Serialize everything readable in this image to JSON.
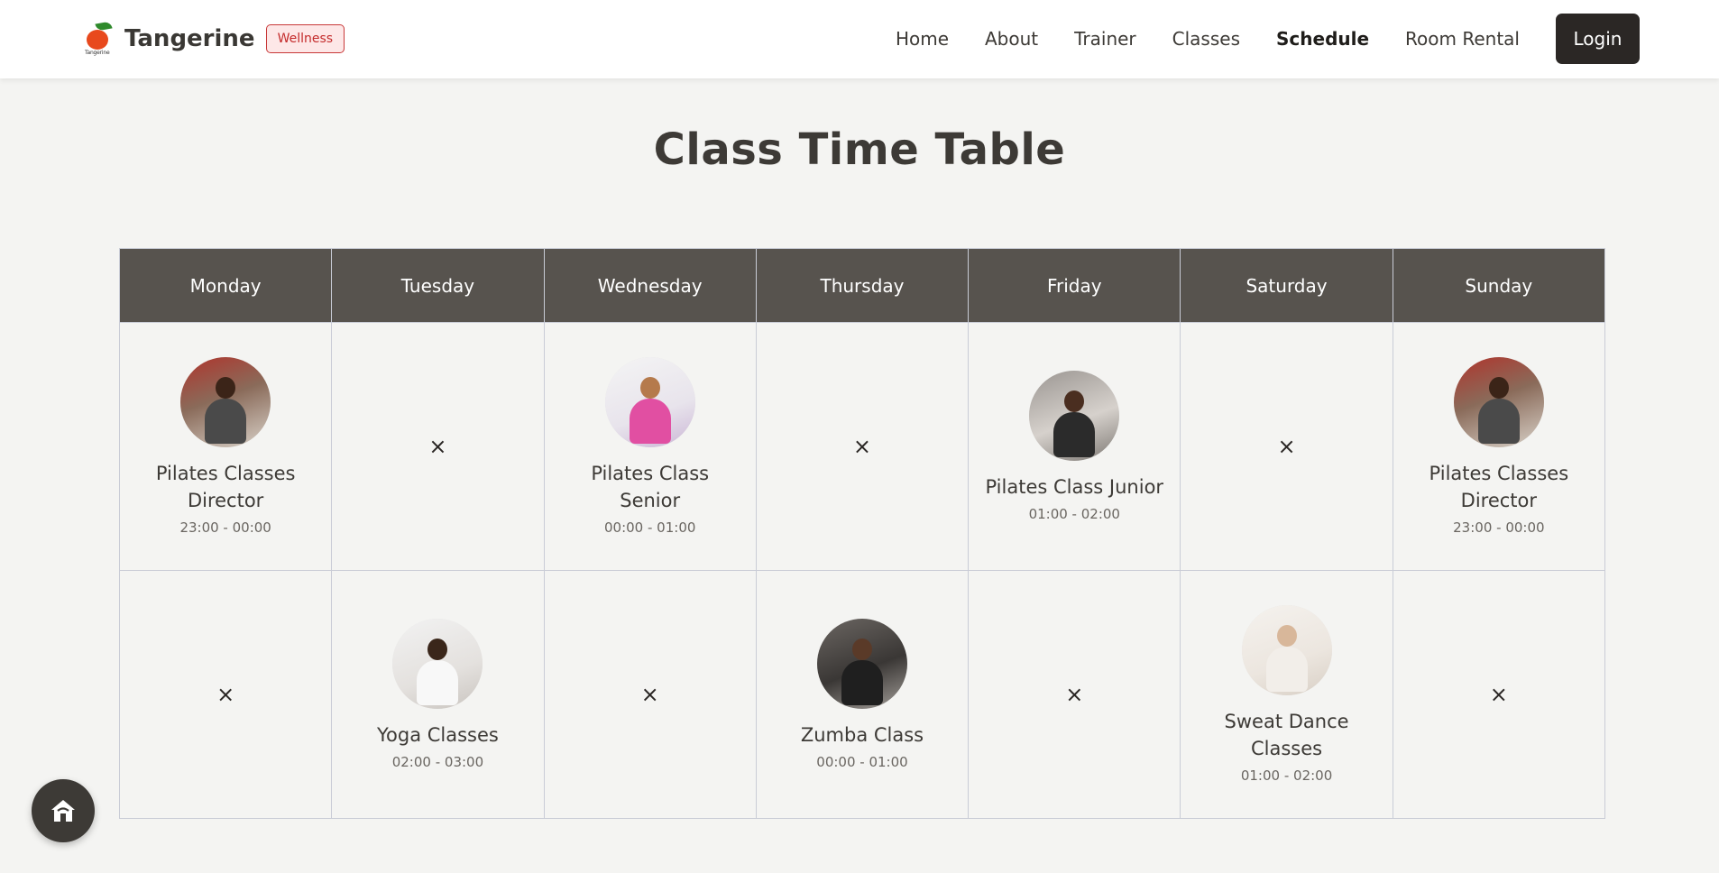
{
  "brand": {
    "name": "Tangerine",
    "badge": "Wellness",
    "logo_small_text": "Tangerine",
    "accent": "#e8491d",
    "badge_color": "#c42b2b"
  },
  "nav": {
    "items": [
      {
        "label": "Home",
        "active": false
      },
      {
        "label": "About",
        "active": false
      },
      {
        "label": "Trainer",
        "active": false
      },
      {
        "label": "Classes",
        "active": false
      },
      {
        "label": "Schedule",
        "active": true
      },
      {
        "label": "Room Rental",
        "active": false
      }
    ],
    "login_label": "Login"
  },
  "page": {
    "title": "Class Time Table"
  },
  "timetable": {
    "days": [
      "Monday",
      "Tuesday",
      "Wednesday",
      "Thursday",
      "Friday",
      "Saturday",
      "Sunday"
    ],
    "header_color": "#57534e",
    "empty_symbol": "×",
    "rows": [
      [
        {
          "name": "Pilates Classes Director",
          "time": "23:00 - 00:00",
          "image": "pilates-director-photo"
        },
        null,
        {
          "name": "Pilates Class Senior",
          "time": "00:00 - 01:00",
          "image": "pilates-senior-photo"
        },
        null,
        {
          "name": "Pilates Class Junior",
          "time": "01:00 - 02:00",
          "image": "pilates-junior-photo"
        },
        null,
        {
          "name": "Pilates Classes Director",
          "time": "23:00 - 00:00",
          "image": "pilates-director-photo"
        }
      ],
      [
        null,
        {
          "name": "Yoga Classes",
          "time": "02:00 - 03:00",
          "image": "yoga-photo"
        },
        null,
        {
          "name": "Zumba Class",
          "time": "00:00 - 01:00",
          "image": "zumba-photo"
        },
        null,
        {
          "name": "Sweat Dance Classes",
          "time": "01:00 - 02:00",
          "image": "sweat-dance-photo"
        },
        null
      ]
    ]
  },
  "fab": {
    "icon": "home-icon"
  }
}
